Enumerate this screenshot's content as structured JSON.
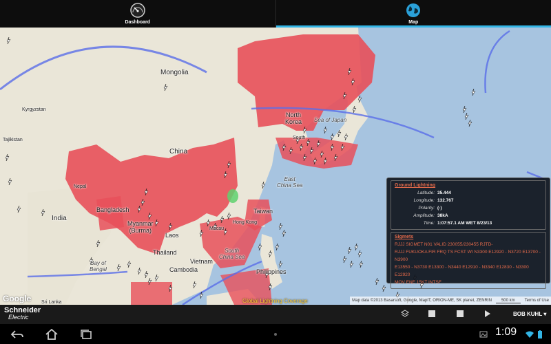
{
  "tabs": [
    {
      "label": "Dashboard",
      "icon": "gauge-icon"
    },
    {
      "label": "Map",
      "icon": "globe-icon",
      "active": true
    }
  ],
  "map": {
    "labels": {
      "mongolia": "Mongolia",
      "kyrgyzstan": "Kyrgyzstan",
      "tajikistan": "Tajikistan",
      "china": "China",
      "nepal": "Nepal",
      "bangladesh": "Bangladesh",
      "india": "India",
      "myanmar": "Myanmar\n(Burma)",
      "laos": "Laos",
      "thailand": "Thailand",
      "vietnam": "Vietnam",
      "cambodia": "Cambodia",
      "sri_lanka": "Sri Lanka",
      "north_korea": "North\nKorea",
      "south_korea": "South",
      "sea_of_japan": "Sea of Japan",
      "east_china_sea": "East\nChina Sea",
      "taiwan": "Taiwan",
      "hong_kong": "Hong Kong",
      "macau": "Macau",
      "south_china_sea": "South\nChina Sea",
      "philippines": "Philippines",
      "bay_of_bengal": "Bay of\nBengal"
    },
    "google_logo": "Google",
    "coverage_label": "Global Lightning Coverage",
    "attribution": "Map data ©2013 Basarsoft, Google, MapIT, ORION-ME, SK planet, ZENRIN",
    "scale": "500 km",
    "terms": "Terms of Use"
  },
  "info_panel": {
    "ground": {
      "title": "Ground Lightning",
      "rows": [
        {
          "k": "Latitude:",
          "v": "35.444"
        },
        {
          "k": "Longitude:",
          "v": "132.767"
        },
        {
          "k": "Polarity:",
          "v": "(-)"
        },
        {
          "k": "Amplitude:",
          "v": "38kA"
        },
        {
          "k": "Time:",
          "v": "1:07:57.1 AM WET 8/23/13"
        }
      ]
    },
    "sigmets": {
      "title": "Sigmets",
      "lines": [
        "RJJJ SIGMET N01 VALID 230055/230455 RJTD-",
        "RJJJ FUKUOKA FIR FRQ TS FCST WI N3300 E12920 - N3720 E13700 - N3900",
        "E13550 - N3730 E13300 - N3440 E12910 - N3340 E12830 - N3300 E12920",
        "MOV ENE 15KT INTSF"
      ]
    }
  },
  "appbar": {
    "brand_line1": "Schneider",
    "brand_line2": "Electric",
    "user": "BOB KUHL"
  },
  "statusbar": {
    "time": "1:09"
  },
  "colors": {
    "accent": "#33b5e5",
    "sigmet_fill": "#e8505a",
    "sigmet_text": "#e46a4a",
    "track": "#5a6ee8"
  }
}
